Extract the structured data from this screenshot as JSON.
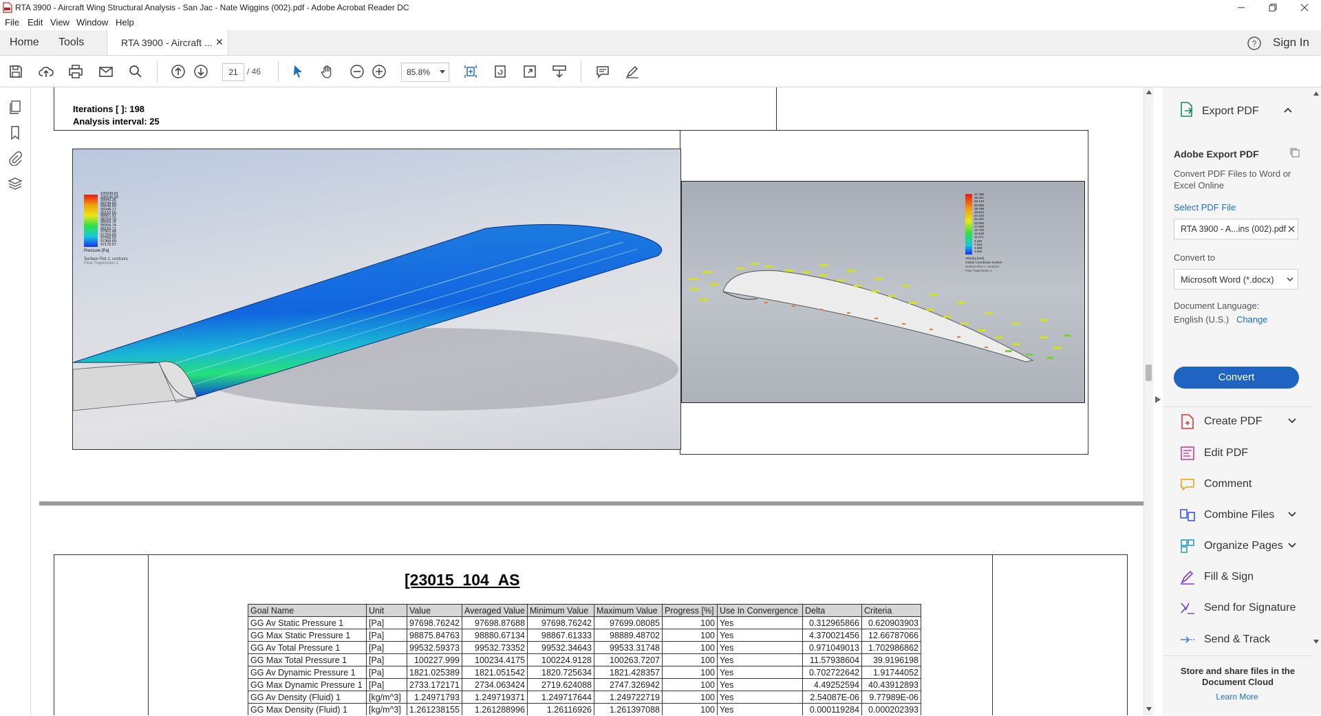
{
  "window": {
    "title": "RTA 3900 - Aircraft Wing Structural Analysis - San Jac - Nate Wiggins (002).pdf - Adobe Acrobat Reader DC"
  },
  "menu": [
    "File",
    "Edit",
    "View",
    "Window",
    "Help"
  ],
  "tabs": {
    "home": "Home",
    "tools": "Tools",
    "doc": "RTA 3900 - Aircraft ..."
  },
  "header": {
    "signin": "Sign In"
  },
  "toolbar": {
    "page_current": "21",
    "page_total": "/ 46",
    "zoom": "85.8%"
  },
  "doc": {
    "iterations": "Iterations [ ]: 198",
    "interval": "Analysis interval: 25",
    "table_title": "[23015_104_AS",
    "legend1": {
      "values": [
        "100339.81",
        "100142.99",
        "99943.36",
        "99744.83",
        "99546.50",
        "99348.17",
        "99150.65",
        "98951.52",
        "98754.79",
        "98556.76",
        "98358.74",
        "98160.71",
        "97962.68",
        "97764.65",
        "97566.62",
        "97368.60",
        "97170.57"
      ],
      "label": "Pressure [Pa]",
      "sub1": "Surface Plot 1: contours",
      "sub2": "Flow Trajectories 1"
    },
    "legend2": {
      "values": [
        "37.498",
        "35.321",
        "33.143",
        "30.966",
        "28.789",
        "26.612",
        "24.434",
        "22.257",
        "20.080",
        "17.903",
        "15.725",
        "13.548",
        "11.371",
        "9.194",
        "7.016",
        "4.839",
        "2.662"
      ],
      "label": "Velocity [m/s]",
      "sub1": "Global Coordinate System",
      "sub2": "Surface Plot 1: contours",
      "sub3": "Flow Trajectories 1"
    },
    "columns": [
      "Goal Name",
      "Unit",
      "Value",
      "Averaged Value",
      "Minimum Value",
      "Maximum Value",
      "Progress [%]",
      "Use In Convergence",
      "Delta",
      "Criteria"
    ],
    "rows": [
      [
        "GG Av Static Pressure 1",
        "[Pa]",
        "97698.76242",
        "97698.87688",
        "97698.76242",
        "97699.08085",
        "100",
        "Yes",
        "0.312965866",
        "0.620903903"
      ],
      [
        "GG Max Static Pressure 1",
        "[Pa]",
        "98875.84763",
        "98880.67134",
        "98867.61333",
        "98889.48702",
        "100",
        "Yes",
        "4.370021456",
        "12.66787066"
      ],
      [
        "GG Av Total Pressure 1",
        "[Pa]",
        "99532.59373",
        "99532.73352",
        "99532.34643",
        "99533.31748",
        "100",
        "Yes",
        "0.971049013",
        "1.702986862"
      ],
      [
        "GG Max Total Pressure 1",
        "[Pa]",
        "100227.999",
        "100234.4175",
        "100224.9128",
        "100263.7207",
        "100",
        "Yes",
        "11.57938604",
        "39.9196198"
      ],
      [
        "GG Av Dynamic Pressure 1",
        "[Pa]",
        "1821.025389",
        "1821.051542",
        "1820.725634",
        "1821.428357",
        "100",
        "Yes",
        "0.702722642",
        "1.91744052"
      ],
      [
        "GG Max Dynamic Pressure 1",
        "[Pa]",
        "2733.172171",
        "2734.063424",
        "2719.624088",
        "2747.326942",
        "100",
        "Yes",
        "4.49252594",
        "40.43912893"
      ],
      [
        "GG Av Density (Fluid) 1",
        "[kg/m^3]",
        "1.24971793",
        "1.249719371",
        "1.249717644",
        "1.249722719",
        "100",
        "Yes",
        "2.54087E-06",
        "9.77989E-06"
      ],
      [
        "GG Max Density (Fluid) 1",
        "[kg/m^3]",
        "1.261238155",
        "1.261288996",
        "1.26116926",
        "1.261397088",
        "100",
        "Yes",
        "0.000119284",
        "0.000202393"
      ]
    ]
  },
  "panel": {
    "export_header": "Export PDF",
    "export_title": "Adobe Export PDF",
    "export_desc": "Convert PDF Files to Word or Excel Online",
    "select_label": "Select PDF File",
    "file_name": "RTA 3900 - A...ins (002).pdf",
    "convert_to_label": "Convert to",
    "convert_to_value": "Microsoft Word (*.docx)",
    "doc_lang_label": "Document Language:",
    "doc_lang_value": "English (U.S.)",
    "change": "Change",
    "convert_button": "Convert",
    "tools": [
      "Create PDF",
      "Edit PDF",
      "Comment",
      "Combine Files",
      "Organize Pages",
      "Fill & Sign",
      "Send for Signature",
      "Send & Track"
    ],
    "cloud_text": "Store and share files in the Document Cloud",
    "learn_more": "Learn More",
    "colors": {
      "accent": "#1a6fc9",
      "convert_bg": "#1f64c2"
    }
  }
}
